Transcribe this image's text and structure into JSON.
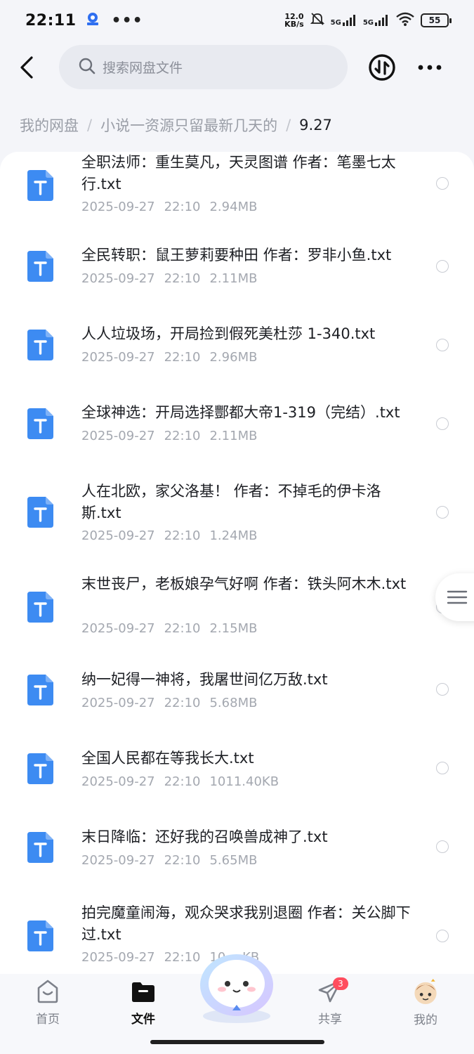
{
  "status_bar": {
    "time": "22:11",
    "dots": "•••",
    "net_speed_value": "12.0",
    "net_speed_unit": "KB/s",
    "signal_1": "5G",
    "signal_2": "5G",
    "battery": "55"
  },
  "header": {
    "search_placeholder": "搜索网盘文件"
  },
  "breadcrumb": {
    "items": [
      "我的网盘",
      "小说一资源只留最新几天的"
    ],
    "current": "9.27",
    "separator": "/"
  },
  "files": [
    {
      "name": "全职法师：重生莫凡，天灵图谱 作者：笔墨七太行.txt",
      "date": "2025-09-27",
      "time": "22:10",
      "size": "2.94MB"
    },
    {
      "name": "全民转职：鼠王萝莉要种田 作者：罗非小鱼.txt",
      "date": "2025-09-27",
      "time": "22:10",
      "size": "2.11MB"
    },
    {
      "name": "人人垃圾场，开局捡到假死美杜莎 1-340.txt",
      "date": "2025-09-27",
      "time": "22:10",
      "size": "2.96MB"
    },
    {
      "name": "全球神选：开局选择酆都大帝1-319（完结）.txt",
      "date": "2025-09-27",
      "time": "22:10",
      "size": "2.11MB"
    },
    {
      "name": "人在北欧，家父洛基！ 作者：不掉毛的伊卡洛斯.txt",
      "date": "2025-09-27",
      "time": "22:10",
      "size": "1.24MB"
    },
    {
      "name": "末世丧尸，老板娘孕气好啊 作者：铁头阿木木.txt",
      "date": "2025-09-27",
      "time": "22:10",
      "size": "2.15MB"
    },
    {
      "name": "纳一妃得一神将，我屠世间亿万敌.txt",
      "date": "2025-09-27",
      "time": "22:10",
      "size": "5.68MB"
    },
    {
      "name": "全国人民都在等我长大.txt",
      "date": "2025-09-27",
      "time": "22:10",
      "size": "1011.40KB"
    },
    {
      "name": "末日降临：还好我的召唤兽成神了.txt",
      "date": "2025-09-27",
      "time": "22:10",
      "size": "5.65MB"
    },
    {
      "name": "拍完魔童闹海，观众哭求我别退圈 作者：关公脚下过.txt",
      "date": "2025-09-27",
      "time": "22:10",
      "size": "10.…KB"
    }
  ],
  "bottom_nav": [
    {
      "label": "首页",
      "icon": "home-icon",
      "active": false
    },
    {
      "label": "文件",
      "icon": "folder-icon",
      "active": true
    },
    {
      "label": "共享",
      "icon": "send-icon",
      "active": false,
      "badge": "3"
    },
    {
      "label": "我的",
      "icon": "avatar-icon",
      "active": false
    }
  ],
  "colors": {
    "file_icon_blue": "#3d8bf2",
    "badge_red": "#ff4d5e",
    "background": "#f4f5f9"
  }
}
